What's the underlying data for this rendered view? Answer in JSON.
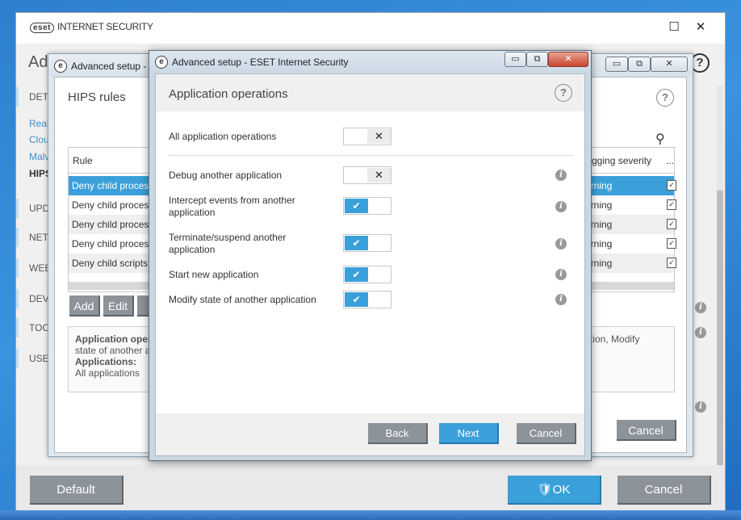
{
  "main_window": {
    "brand_logo": "eset",
    "brand_name": "INTERNET SECURITY",
    "heading": "Ad",
    "help": "?",
    "window_controls": {
      "maximize": "☐",
      "close": "✕"
    },
    "sidebar": {
      "items": [
        {
          "label": "DET"
        },
        {
          "label": "UPD"
        },
        {
          "label": "NET"
        },
        {
          "label": "WEB"
        },
        {
          "label": "DEV"
        },
        {
          "label": "TOO"
        },
        {
          "label": "USE"
        }
      ],
      "sub_items": [
        {
          "label": "Real"
        },
        {
          "label": "Clou"
        },
        {
          "label": "Malv"
        },
        {
          "label": "HIPS"
        }
      ]
    },
    "footer": {
      "default_label": "Default",
      "ok_label": "OK",
      "cancel_label": "Cancel"
    }
  },
  "hips_dialog": {
    "title": "Advanced setup -",
    "heading": "HIPS rules",
    "help": "?",
    "window_controls": {
      "minimize": "▭",
      "maximize": "⧉",
      "close": "✕"
    },
    "table": {
      "col_rule": "Rule",
      "col_severity": "gging severity",
      "col_more": "...",
      "rows": [
        {
          "rule": "Deny child process",
          "severity": "arning",
          "checked": "✓"
        },
        {
          "rule": "Deny child process",
          "severity": "arning",
          "checked": "✓"
        },
        {
          "rule": "Deny child process",
          "severity": "arning",
          "checked": "✓"
        },
        {
          "rule": "Deny child process",
          "severity": "arning",
          "checked": "✓"
        },
        {
          "rule": "Deny child scripts",
          "severity": "arning",
          "checked": "✓"
        }
      ]
    },
    "buttons": {
      "add": "Add",
      "edit": "Edit",
      "delete": "D"
    },
    "description": {
      "line1_bold": "Application oper",
      "line1_right": "lication, Modify",
      "line2": "state of another a",
      "line3_bold": "Applications:",
      "line4": "All applications"
    },
    "cancel_label": "Cancel"
  },
  "ops_dialog": {
    "title": "Advanced setup - ESET Internet Security",
    "heading": "Application operations",
    "help": "?",
    "window_controls": {
      "minimize": "▭",
      "maximize": "⧉",
      "close": "✕"
    },
    "all_ops": {
      "label": "All application operations",
      "state": "off"
    },
    "operations": [
      {
        "label": "Debug another application",
        "state": "off"
      },
      {
        "label": "Intercept events from another application",
        "state": "on"
      },
      {
        "label": "Terminate/suspend another application",
        "state": "on"
      },
      {
        "label": "Start new application",
        "state": "on"
      },
      {
        "label": "Modify state of another application",
        "state": "on"
      }
    ],
    "toggle_glyphs": {
      "off": "✕",
      "on": "✔"
    },
    "info_glyph": "i",
    "buttons": {
      "back": "Back",
      "next": "Next",
      "cancel": "Cancel"
    }
  }
}
